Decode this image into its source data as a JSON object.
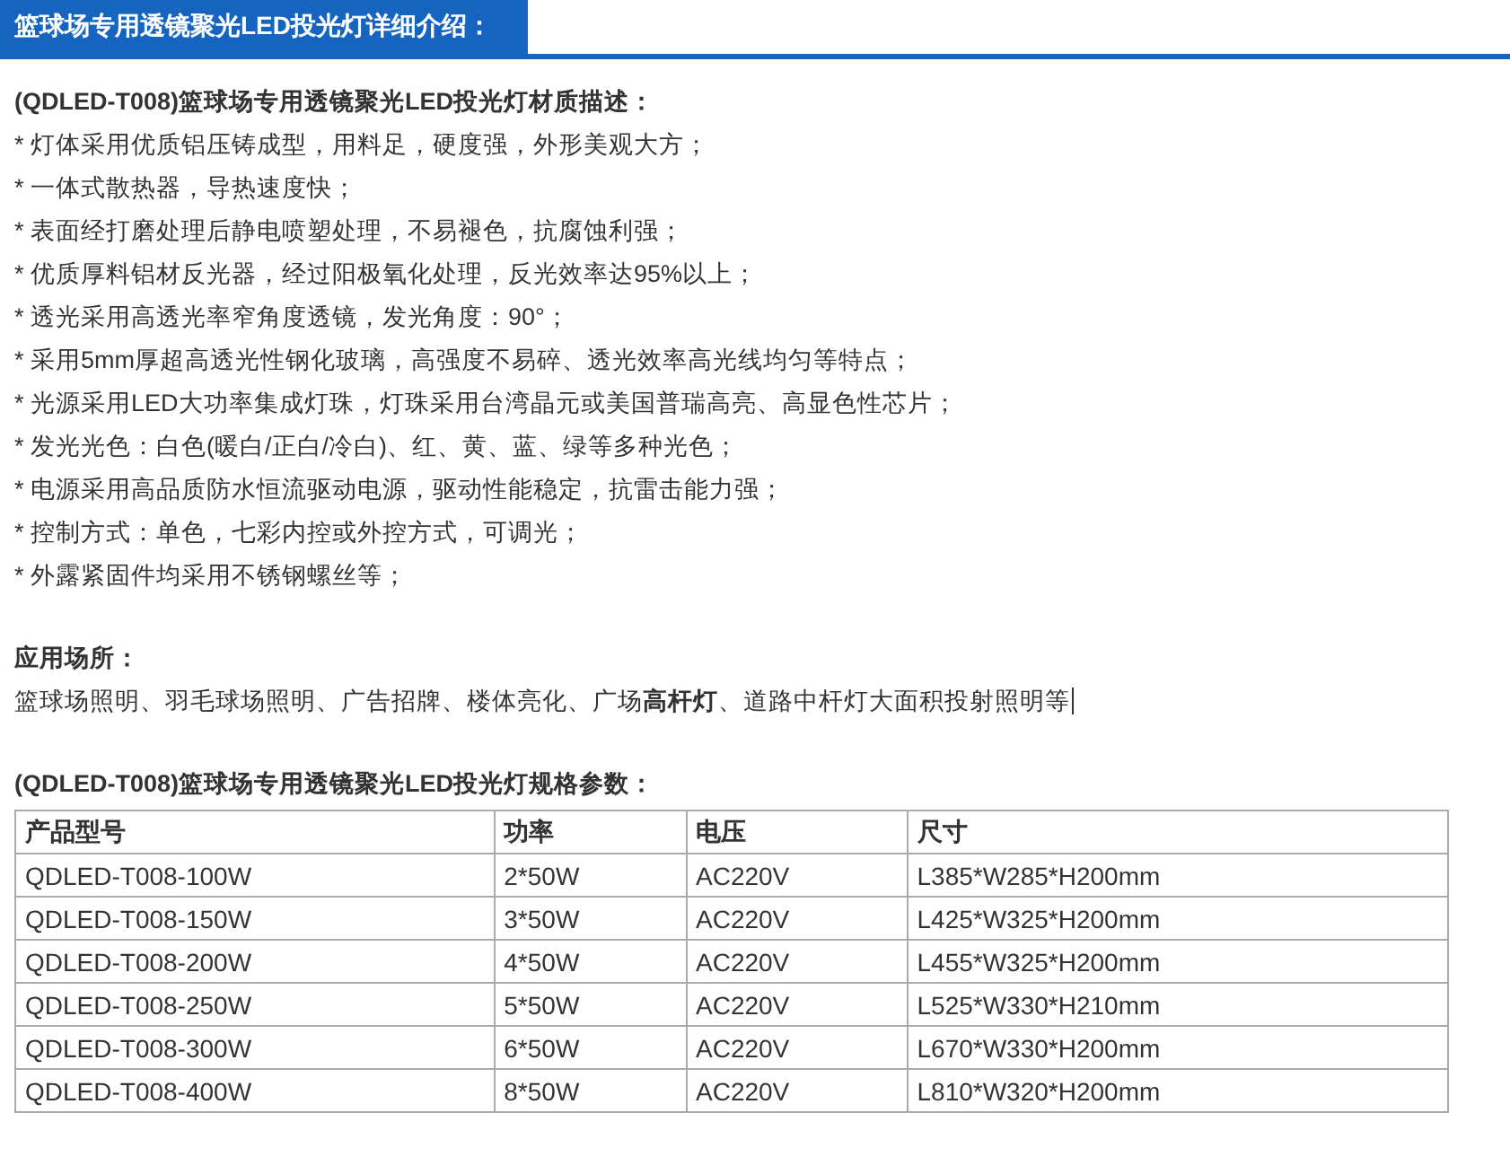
{
  "header": {
    "tab_title": "篮球场专用透镜聚光LED投光灯详细介绍："
  },
  "material": {
    "title": "(QDLED-T008)篮球场专用透镜聚光LED投光灯材质描述：",
    "items": [
      "* 灯体采用优质铝压铸成型，用料足，硬度强，外形美观大方；",
      "* 一体式散热器，导热速度快；",
      "* 表面经打磨处理后静电喷塑处理，不易褪色，抗腐蚀利强；",
      "* 优质厚料铝材反光器，经过阳极氧化处理，反光效率达95%以上；",
      "* 透光采用高透光率窄角度透镜，发光角度：90°；",
      "* 采用5mm厚超高透光性钢化玻璃，高强度不易碎、透光效率高光线均匀等特点；",
      "* 光源采用LED大功率集成灯珠，灯珠采用台湾晶元或美国普瑞高亮、高显色性芯片；",
      "* 发光光色：白色(暖白/正白/冷白)、红、黄、蓝、绿等多种光色；",
      "* 电源采用高品质防水恒流驱动电源，驱动性能稳定，抗雷击能力强；",
      "* 控制方式：单色，七彩内控或外控方式，可调光；",
      "* 外露紧固件均采用不锈钢螺丝等；"
    ]
  },
  "usage": {
    "title": "应用场所：",
    "text": "篮球场照明、羽毛球场照明、广告招牌、楼体亮化、广场**高杆灯**、道路中杆灯大面积投射照明等"
  },
  "specs": {
    "title": "(QDLED-T008)篮球场专用透镜聚光LED投光灯规格参数：",
    "columns": [
      "产品型号",
      "功率",
      "电压",
      "尺寸"
    ],
    "rows": [
      [
        "QDLED-T008-100W",
        "2*50W",
        "AC220V",
        "L385*W285*H200mm"
      ],
      [
        "QDLED-T008-150W",
        "3*50W",
        "AC220V",
        "L425*W325*H200mm"
      ],
      [
        "QDLED-T008-200W",
        "4*50W",
        "AC220V",
        "L455*W325*H200mm"
      ],
      [
        "QDLED-T008-250W",
        "5*50W",
        "AC220V",
        "L525*W330*H210mm"
      ],
      [
        "QDLED-T008-300W",
        "6*50W",
        "AC220V",
        "L670*W330*H200mm"
      ],
      [
        "QDLED-T008-400W",
        "8*50W",
        "AC220V",
        "L810*W320*H200mm"
      ]
    ]
  }
}
